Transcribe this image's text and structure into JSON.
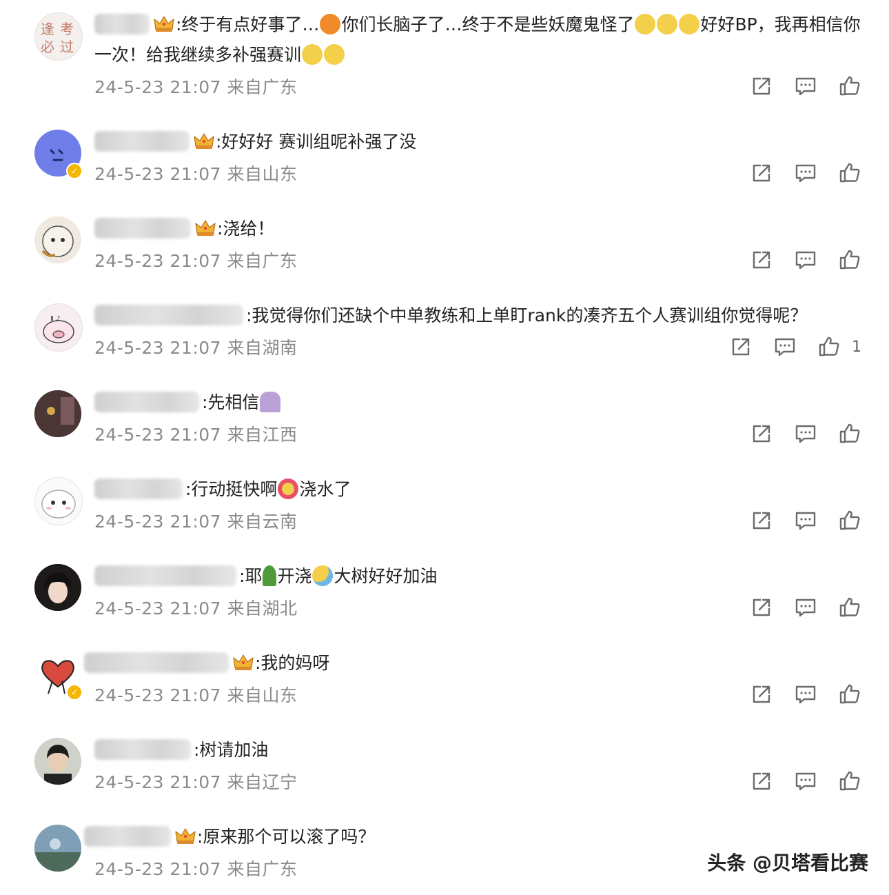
{
  "comments": [
    {
      "text": ":终于有点好事了…",
      "text2": "你们长脑子了…终于不是些妖魔鬼怪了",
      "text3": "好好BP，我再相信你一次！给我继续多补强赛训",
      "time": "24-5-23 21:07",
      "location": "来自广东"
    },
    {
      "text": ":好好好 赛训组呢补强了没",
      "time": "24-5-23 21:07",
      "location": "来自山东"
    },
    {
      "text": ":浇给！",
      "time": "24-5-23 21:07",
      "location": "来自广东"
    },
    {
      "text": ":我觉得你们还缺个中单教练和上单盯rank的凑齐五个人赛训组你觉得呢？",
      "time": "24-5-23 21:07",
      "location": "来自湖南",
      "likes": "1"
    },
    {
      "text": ":先相信",
      "time": "24-5-23 21:07",
      "location": "来自江西"
    },
    {
      "text": ":行动挺快啊",
      "text2": "浇水了",
      "time": "24-5-23 21:07",
      "location": "来自云南"
    },
    {
      "text": ":耶",
      "text2": "开浇",
      "text3": "大树好好加油",
      "time": "24-5-23 21:07",
      "location": "来自湖北"
    },
    {
      "text": ":我的妈呀",
      "time": "24-5-23 21:07",
      "location": "来自山东"
    },
    {
      "text": ":树请加油",
      "time": "24-5-23 21:07",
      "location": "来自辽宁"
    },
    {
      "text": ":原来那个可以滚了吗？",
      "time": "24-5-23 21:07",
      "location": "来自广东"
    }
  ],
  "icons": {
    "share": "share-icon",
    "comment": "comment-icon",
    "like": "thumbs-up-icon",
    "crown": "crown-badge-icon",
    "verified": "verified-badge-icon"
  },
  "watermark": "头条 @贝塔看比赛",
  "colors": {
    "text": "#222222",
    "meta": "#8a8a8a",
    "icon": "#6b6b6b",
    "verified": "#f5b800"
  }
}
